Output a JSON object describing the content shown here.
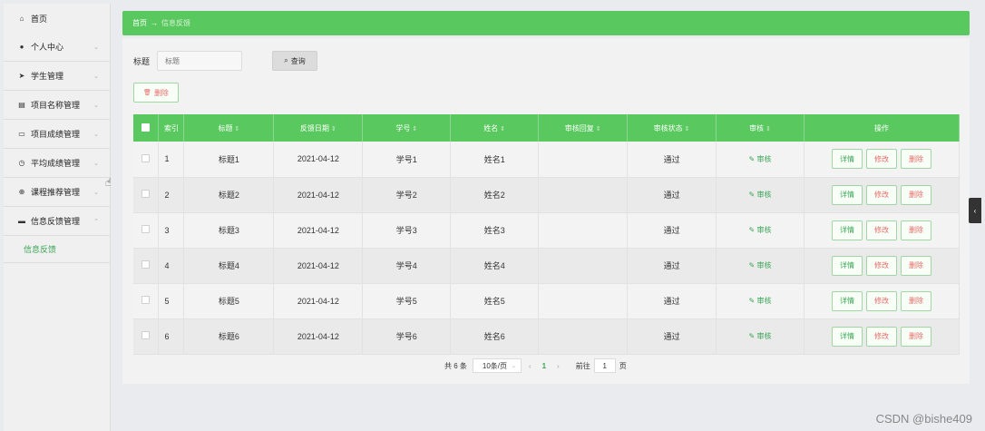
{
  "sidebar": {
    "items": [
      {
        "label": "首页",
        "icon": "home-icon",
        "glyph": "⌂",
        "chev": ""
      },
      {
        "label": "个人中心",
        "icon": "user-icon",
        "glyph": "●",
        "chev": "⌄"
      },
      {
        "label": "学生管理",
        "icon": "send-icon",
        "glyph": "➤",
        "chev": "⌄"
      },
      {
        "label": "项目名称管理",
        "icon": "file-icon",
        "glyph": "▤",
        "chev": "⌄"
      },
      {
        "label": "项目成绩管理",
        "icon": "chart-icon",
        "glyph": "▭",
        "chev": "⌄"
      },
      {
        "label": "平均成绩管理",
        "icon": "clock-icon",
        "glyph": "◷",
        "chev": "⌄"
      },
      {
        "label": "课程推荐管理",
        "icon": "globe-icon",
        "glyph": "⊕",
        "chev": "⌄"
      },
      {
        "label": "信息反馈管理",
        "icon": "folder-icon",
        "glyph": "▬",
        "chev": "⌃"
      }
    ],
    "sub_item": "信息反馈"
  },
  "breadcrumb": {
    "home": "首页",
    "arrow": "→",
    "current": "信息反馈"
  },
  "search": {
    "label": "标题",
    "placeholder": "标题",
    "button": "查询",
    "button_icon": "⌕"
  },
  "toolbar": {
    "delete_label": "删除",
    "delete_icon": "🗑"
  },
  "table": {
    "headers": [
      "索引",
      "标题",
      "反馈日期",
      "学号",
      "姓名",
      "审核回复",
      "审核状态",
      "审核",
      "操作"
    ],
    "sort_glyph": "⇕",
    "rows": [
      {
        "idx": "1",
        "title": "标题1",
        "date": "2021-04-12",
        "xuehao": "学号1",
        "name": "姓名1",
        "reply": "",
        "status": "通过",
        "audit": "✎ 审核"
      },
      {
        "idx": "2",
        "title": "标题2",
        "date": "2021-04-12",
        "xuehao": "学号2",
        "name": "姓名2",
        "reply": "",
        "status": "通过",
        "audit": "✎ 审核"
      },
      {
        "idx": "3",
        "title": "标题3",
        "date": "2021-04-12",
        "xuehao": "学号3",
        "name": "姓名3",
        "reply": "",
        "status": "通过",
        "audit": "✎ 审核"
      },
      {
        "idx": "4",
        "title": "标题4",
        "date": "2021-04-12",
        "xuehao": "学号4",
        "name": "姓名4",
        "reply": "",
        "status": "通过",
        "audit": "✎ 审核"
      },
      {
        "idx": "5",
        "title": "标题5",
        "date": "2021-04-12",
        "xuehao": "学号5",
        "name": "姓名5",
        "reply": "",
        "status": "通过",
        "audit": "✎ 审核"
      },
      {
        "idx": "6",
        "title": "标题6",
        "date": "2021-04-12",
        "xuehao": "学号6",
        "name": "姓名6",
        "reply": "",
        "status": "通过",
        "audit": "✎ 审核"
      }
    ],
    "ops": {
      "view": "详情",
      "edit": "修改",
      "delete": "删除"
    }
  },
  "pager": {
    "total": "共 6 条",
    "page_size": "10条/页",
    "prev": "‹",
    "current": "1",
    "next": "›",
    "goto": "前往",
    "goto_value": "1",
    "page_unit": "页"
  },
  "watermark": "CSDN @bishe409",
  "colors": {
    "accent": "#59c85f",
    "danger": "#e86a6a",
    "link": "#3aa655"
  }
}
